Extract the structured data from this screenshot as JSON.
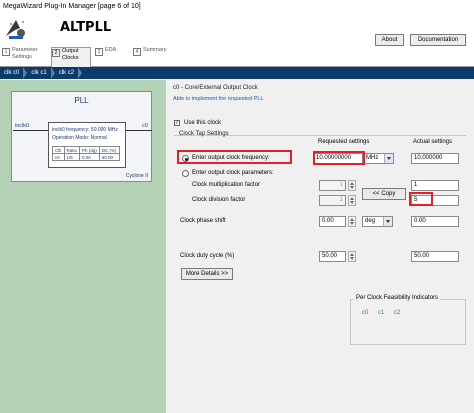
{
  "window": {
    "title": "MegaWizard Plug-In Manager [page 6 of 10]"
  },
  "header": {
    "app_name": "ALTPLL",
    "about_label": "About",
    "documentation_label": "Documentation"
  },
  "tabs": [
    {
      "num": "1",
      "label": "Parameter\nSettings"
    },
    {
      "num": "2",
      "label": "Output\nClocks"
    },
    {
      "num": "3",
      "label": "EDA"
    },
    {
      "num": "4",
      "label": "Summary"
    }
  ],
  "breadcrumbs": [
    "clk c0",
    "clk c1",
    "clk c2"
  ],
  "pll": {
    "title": "PLL",
    "input": "inclk0",
    "output": "c0",
    "freq": "inclk0 frequency: 50.000 MHz",
    "mode": "Operation Mode: Normal",
    "table_header": [
      "Clk",
      "Ratio",
      "Ph (dg)",
      "DC (%)"
    ],
    "table_row": [
      "c0",
      "1/5",
      "0.00",
      "50.00"
    ],
    "family": "Cyclone II"
  },
  "main": {
    "title": "c0 - Core/External Output Clock",
    "subtitle": "Able to implement the requested PLL",
    "use_clock": "Use this clock",
    "group_title": "Clock Tap Settings",
    "requested_header": "Requested settings",
    "actual_header": "Actual settings",
    "radio_freq": "Enter output clock frequency:",
    "radio_params": "Enter output clock parameters:",
    "mult_label": "Clock multiplication factor",
    "div_label": "Clock division factor",
    "phase_label": "Clock phase shift",
    "duty_label": "Clock duty cycle (%)",
    "freq_value": "10.00000000",
    "freq_unit": "MHz",
    "mult_value": "1",
    "div_value": "1",
    "copy_button": "<< Copy",
    "actual_freq": "10.000000",
    "actual_mult": "1",
    "actual_div": "5",
    "phase_value": "0.00",
    "phase_unit": "deg",
    "actual_phase": "0.00",
    "duty_value": "50.00",
    "actual_duty": "50.00",
    "more_details": "More Details >>",
    "feasibility_title": "Per Clock Feasibility Indicators",
    "feasibility_items": [
      "c0",
      "c1",
      "c2"
    ]
  },
  "colors": {
    "highlight": "#e0202a",
    "breadcrumb_bg": "#0b3a6b",
    "left_pane": "#b2d1b5",
    "ok": "#2f8f3a"
  }
}
